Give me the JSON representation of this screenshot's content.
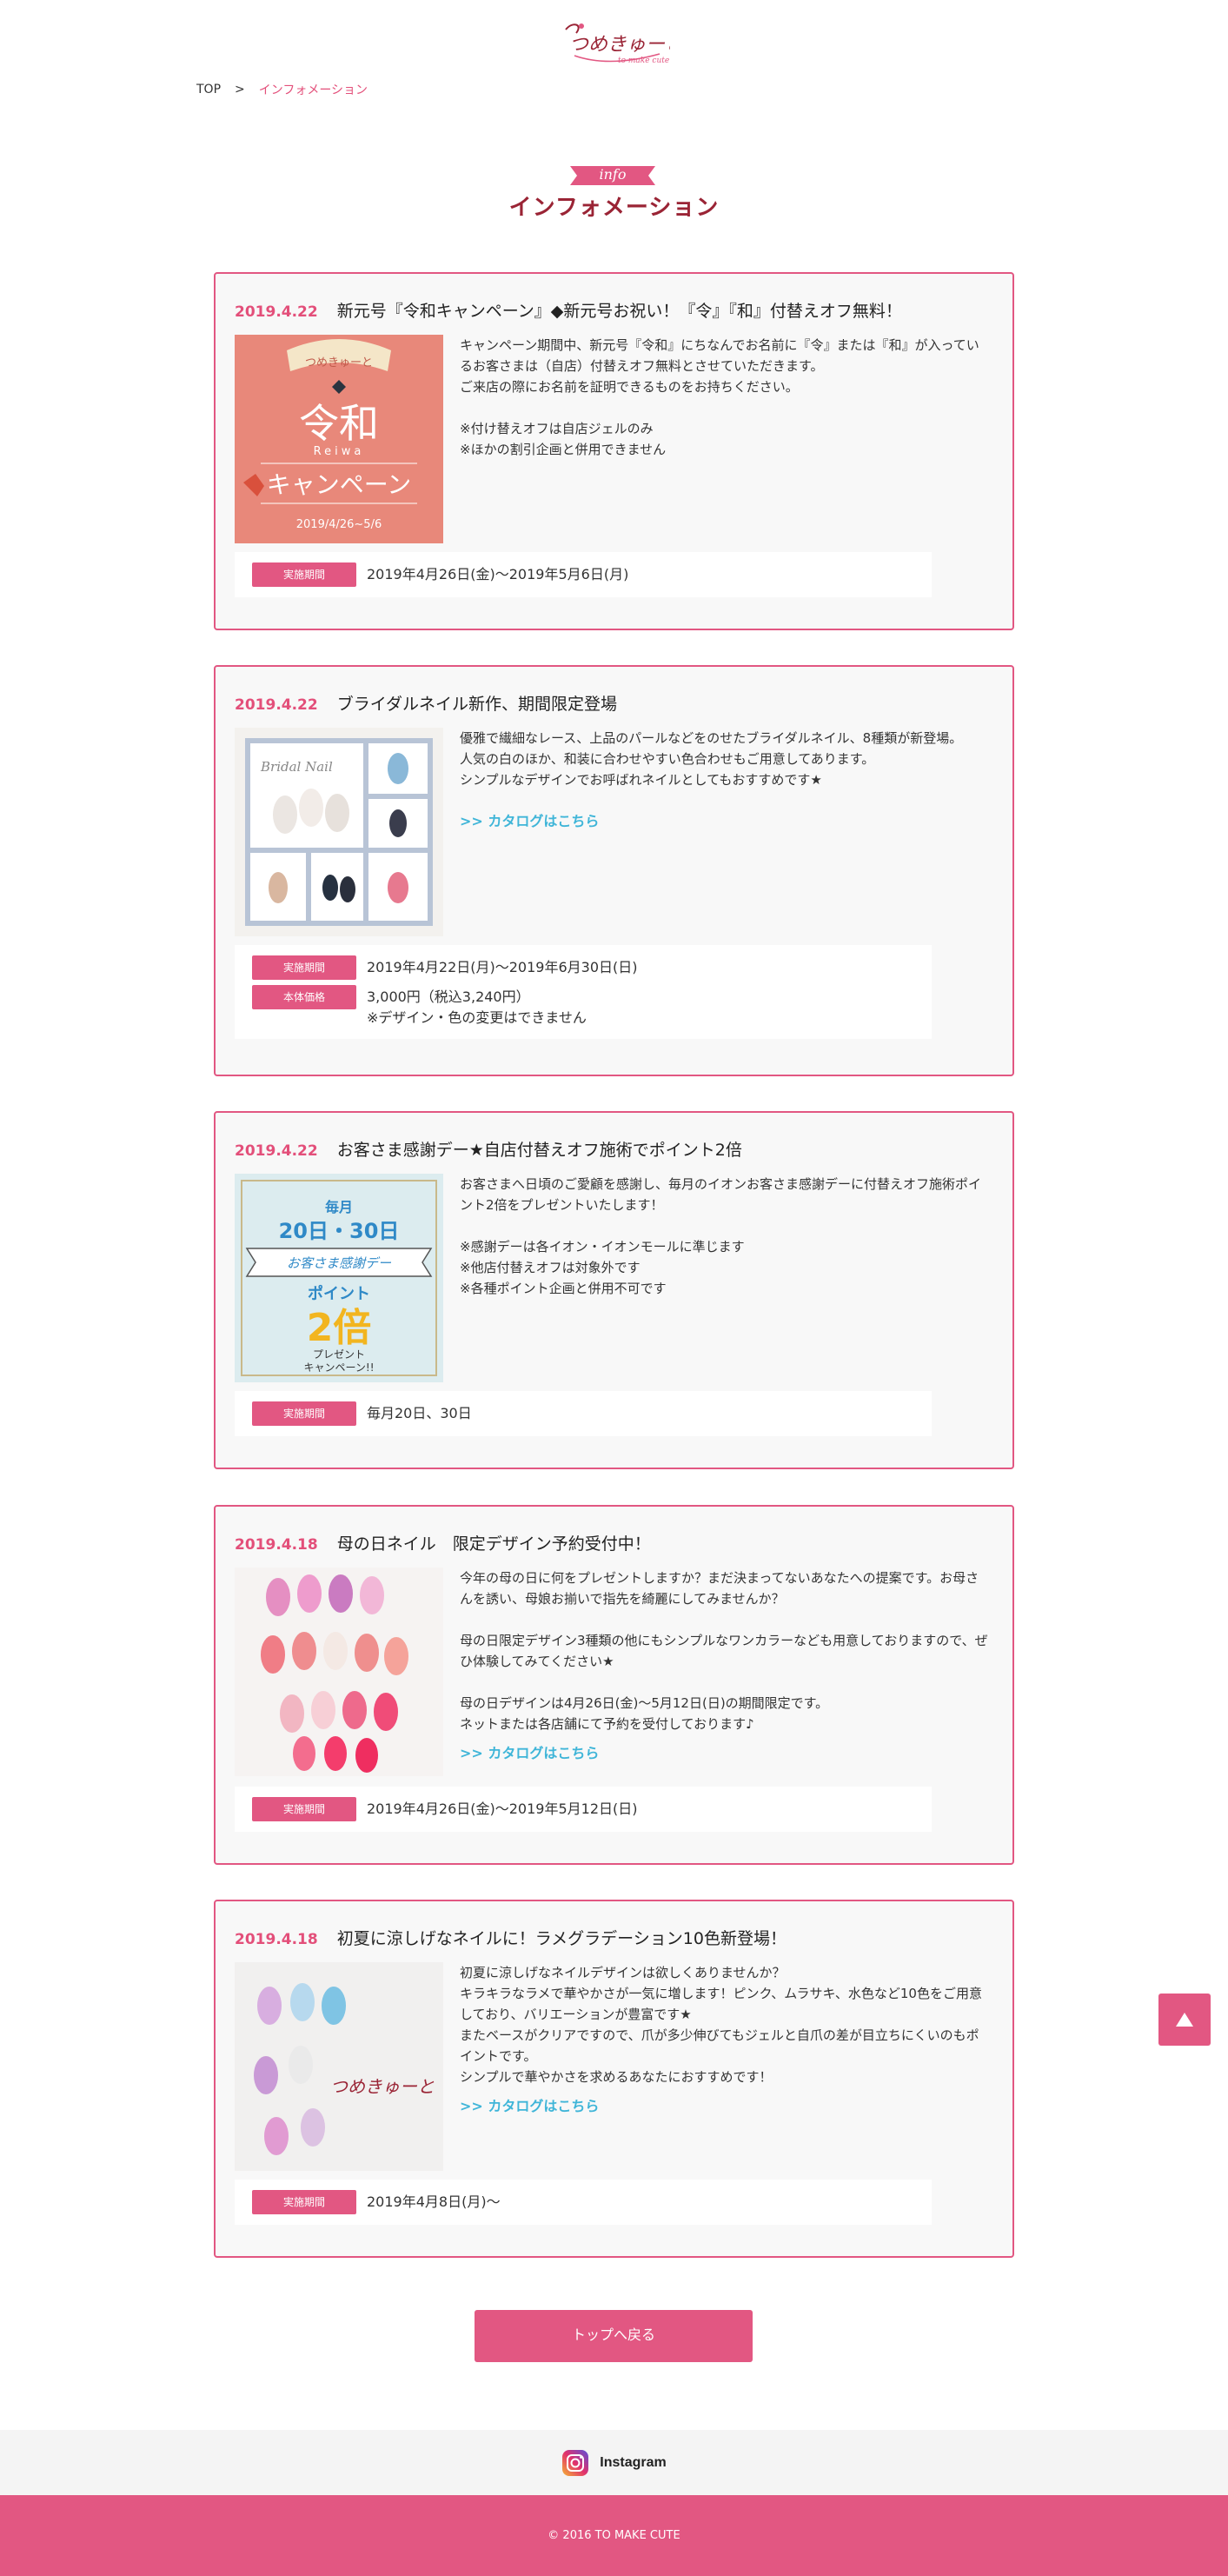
{
  "header": {
    "logo_text": "つめきゅーと",
    "logo_sub": "to make cute"
  },
  "breadcrumb": {
    "home": "TOP",
    "separator": ">",
    "current": "インフォメーション"
  },
  "section": {
    "ribbon": "info",
    "title": "インフォメーション"
  },
  "colors": {
    "accent": "#e25782",
    "title": "#9a2435",
    "link": "#3fb5d8"
  },
  "posts": [
    {
      "date": "2019.4.22",
      "title": "新元号『令和キャンペーン』◆新元号お祝い！『令』『和』付替えオフ無料！",
      "image": {
        "label": "つめきゅーと",
        "main": "令和",
        "sub": "Reiwa",
        "campaign": "キャンペーン",
        "period": "2019/4/26~5/6"
      },
      "body": [
        "キャンペーン期間中、新元号『令和』にちなんでお名前に『令』または『和』が入っているお客さまは（自店）付替えオフ無料とさせていただきます。",
        "ご来店の際にお名前を証明できるものをお持ちください。",
        "",
        "※付け替えオフは自店ジェルのみ",
        "※ほかの割引企画と併用できません"
      ],
      "meta": [
        {
          "label": "実施期間",
          "value": "2019年4月26日(金)〜2019年5月6日(月)"
        }
      ]
    },
    {
      "date": "2019.4.22",
      "title": "ブライダルネイル新作、期間限定登場",
      "image": {
        "label": "Bridal Nail"
      },
      "body": [
        "優雅で繊細なレース、上品のパールなどをのせたブライダルネイル、8種類が新登場。",
        "人気の白のほか、和装に合わせやすい色合わせもご用意してあります。",
        "シンプルなデザインでお呼ばれネイルとしてもおすすめです★"
      ],
      "link": ">> カタログはこちら",
      "meta": [
        {
          "label": "実施期間",
          "value": "2019年4月22日(月)〜2019年6月30日(日)"
        },
        {
          "label": "本体価格",
          "value": "3,000円（税込3,240円）",
          "note": "※デザイン・色の変更はできません"
        }
      ]
    },
    {
      "date": "2019.4.22",
      "title": "お客さま感謝デー★自店付替えオフ施術でポイント2倍",
      "image": {
        "top": "毎月",
        "days": "20日・30日",
        "banner": "お客さま感謝デー",
        "point": "ポイント",
        "double": "2倍",
        "present": "プレゼント",
        "campaign": "キャンペーン!!"
      },
      "body": [
        "お客さまへ日頃のご愛顧を感謝し、毎月のイオンお客さま感謝デーに付替えオフ施術ポイント2倍をプレゼントいたします！",
        "",
        "※感謝デーは各イオン・イオンモールに準じます",
        "※他店付替えオフは対象外です",
        "※各種ポイント企画と併用不可です"
      ],
      "meta": [
        {
          "label": "実施期間",
          "value": "毎月20日、30日"
        }
      ]
    },
    {
      "date": "2019.4.18",
      "title": "母の日ネイル　限定デザイン予約受付中！",
      "image": {},
      "body": [
        "今年の母の日に何をプレゼントしますか？まだ決まってないあなたへの提案です。お母さんを誘い、母娘お揃いで指先を綺麗にしてみませんか？",
        "",
        "母の日限定デザイン3種類の他にもシンプルなワンカラーなども用意しておりますので、ぜひ体験してみてください★",
        "",
        "母の日デザインは4月26日(金)〜5月12日(日)の期間限定です。",
        "ネットまたは各店舗にて予約を受付しております♪"
      ],
      "link": ">> カタログはこちら",
      "meta": [
        {
          "label": "実施期間",
          "value": "2019年4月26日(金)〜2019年5月12日(日)"
        }
      ]
    },
    {
      "date": "2019.4.18",
      "title": "初夏に涼しげなネイルに！ラメグラデーション10色新登場！",
      "image": {
        "label": "つめきゅーと"
      },
      "body": [
        "初夏に涼しげなネイルデザインは欲しくありませんか？",
        "キラキラなラメで華やかさが一気に増します！ピンク、ムラサキ、水色など10色をご用意しており、バリエーションが豊富です★",
        "またベースがクリアですので、爪が多少伸びてもジェルと自爪の差が目立ちにくいのもポイントです。",
        "シンプルで華やかさを求めるあなたにおすすめです！"
      ],
      "link": ">> カタログはこちら",
      "meta": [
        {
          "label": "実施期間",
          "value": "2019年4月8日(月)〜"
        }
      ]
    }
  ],
  "back_button": "トップへ戻る",
  "totop_icon": "arrow-up-icon",
  "instagram": {
    "icon": "instagram-icon",
    "label": "Instagram"
  },
  "footer": {
    "copyright": "© 2016 TO MAKE CUTE"
  }
}
